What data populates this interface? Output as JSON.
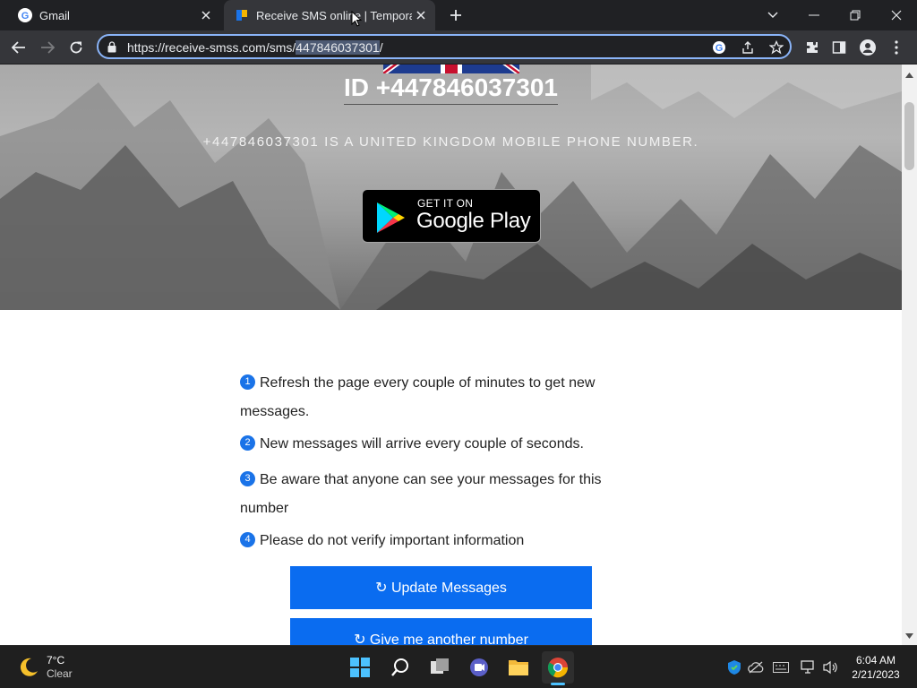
{
  "browser": {
    "tabs": [
      {
        "title": "Gmail",
        "active": false
      },
      {
        "title": "Receive SMS online | Temporary P",
        "active": true
      }
    ],
    "url_prefix": "https://receive-smss.com/sms/",
    "url_selected": "447846037301",
    "url_suffix": "/"
  },
  "page": {
    "hero_title": "ID +447846037301",
    "hero_subtitle": "+447846037301 IS A UNITED KINGDOM MOBILE PHONE NUMBER.",
    "google_play": {
      "small": "GET IT ON",
      "big": "Google Play"
    },
    "instructions": [
      {
        "num": "1",
        "text": "Refresh the page every couple of minutes to get new messages."
      },
      {
        "num": "2",
        "text": "New messages will arrive every couple of seconds."
      },
      {
        "num": "3",
        "text": "Be aware that anyone can see your messages for this number"
      },
      {
        "num": "4",
        "text": "Please do not verify important information"
      }
    ],
    "buttons": {
      "update": "↻ Update Messages",
      "another": "↻ Give me another number"
    }
  },
  "taskbar": {
    "weather_temp": "7°C",
    "weather_cond": "Clear",
    "time": "6:04 AM",
    "date": "2/21/2023"
  },
  "colors": {
    "accent": "#8ab4f8",
    "button": "#0a6cf0",
    "number_badge": "#1a73e8"
  }
}
